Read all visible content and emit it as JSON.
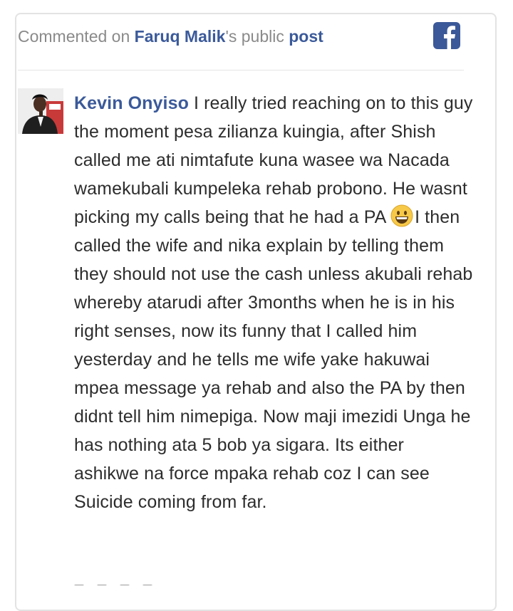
{
  "header": {
    "prefix": "Commented on ",
    "page_owner": "Faruq Malik",
    "middle": "'s public ",
    "post_link": "post",
    "platform_icon": "facebook-icon"
  },
  "comment": {
    "author": "Kevin Onyiso",
    "text_before_emoji": " I really tried reaching on to this guy the moment pesa zilianza kuingia, after Shish called me ati nimtafute kuna wasee wa Nacada wamekubali kumpeleka rehab probono. He wasnt picking my calls being that he had a PA ",
    "emoji": "grinning-face-emoji",
    "text_after_emoji": "I then called the wife and nika explain by telling them they should not use the cash unless akubali rehab whereby atarudi after 3months when he is in his right senses, now its funny that I called him yesterday and he tells me wife yake hakuwai mpea message ya rehab and also the PA by then didnt tell him nimepiga. Now maji imezidi Unga he has nothing ata 5 bob ya sigara. Its either ashikwe na force mpaka rehab coz I can see Suicide coming from far."
  },
  "colors": {
    "link": "#3b5a9a",
    "muted": "#8a8a8a",
    "body_text": "#2d2d2d",
    "facebook_blue": "#3b5998"
  }
}
